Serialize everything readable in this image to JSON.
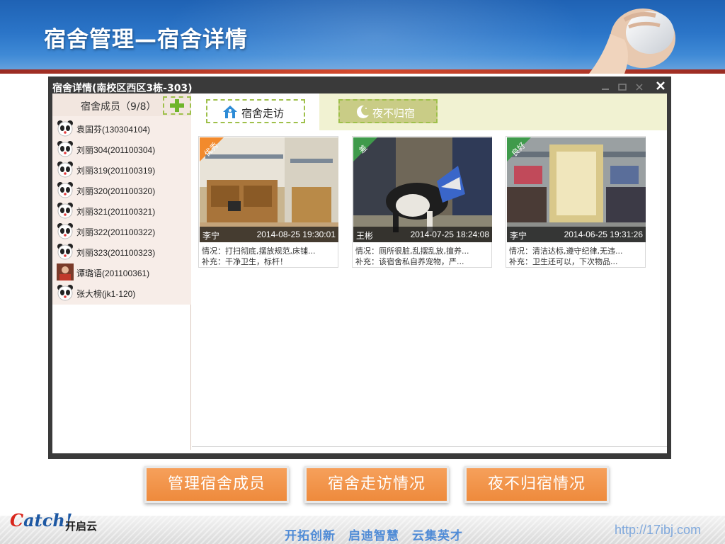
{
  "page": {
    "title": "宿舍管理—宿舍详情"
  },
  "window": {
    "title": "宿舍详情(南校区西区3栋-303)"
  },
  "members": {
    "header_label": "宿舍成员（9/8）",
    "items": [
      {
        "name": "袁国芬(130304104)",
        "avatar": "panda-avatar-icon"
      },
      {
        "name": "刘丽304(201100304)",
        "avatar": "panda-avatar-icon"
      },
      {
        "name": "刘丽319(201100319)",
        "avatar": "panda-avatar-icon"
      },
      {
        "name": "刘丽320(201100320)",
        "avatar": "panda-avatar-icon"
      },
      {
        "name": "刘丽321(201100321)",
        "avatar": "panda-avatar-icon"
      },
      {
        "name": "刘丽322(201100322)",
        "avatar": "panda-avatar-icon"
      },
      {
        "name": "刘丽323(201100323)",
        "avatar": "panda-avatar-icon"
      },
      {
        "name": "谭璐语(201100361)",
        "avatar": "photo-avatar"
      },
      {
        "name": "张大榜(jk1-120)",
        "avatar": "panda-avatar-icon"
      }
    ]
  },
  "tabs": {
    "visit": "宿舍走访",
    "night": "夜不归宿"
  },
  "visits": [
    {
      "ribbon": "优秀",
      "ribbon_color": "#f28a2c",
      "name": "李宁",
      "time": "2014-08-25 19:30:01",
      "situation": "情况：打扫彻底,摆放规范,床铺...",
      "remark": "补充：干净卫生，标杆！"
    },
    {
      "ribbon": "差",
      "ribbon_color": "#3f9a4b",
      "name": "王彬",
      "time": "2014-07-25 18:24:08",
      "situation": "情况：厕所很脏,乱摆乱放,擅养...",
      "remark": "补充：该宿舍私自养宠物，严..."
    },
    {
      "ribbon": "良好",
      "ribbon_color": "#3f9a4b",
      "name": "李宁",
      "time": "2014-06-25 19:31:26",
      "situation": "情况：清洁达标,遵守纪律,无违...",
      "remark": "补充：卫生还可以，下次物品..."
    }
  ],
  "features": [
    "管理宿舍成员",
    "宿舍走访情况",
    "夜不归宿情况"
  ],
  "footer": {
    "logo_text": "atch!",
    "logo_prefix": "C",
    "brand": "开启云",
    "slogan": "开拓创新　启迪智慧　云集英才",
    "url": "http://17ibj.com"
  }
}
